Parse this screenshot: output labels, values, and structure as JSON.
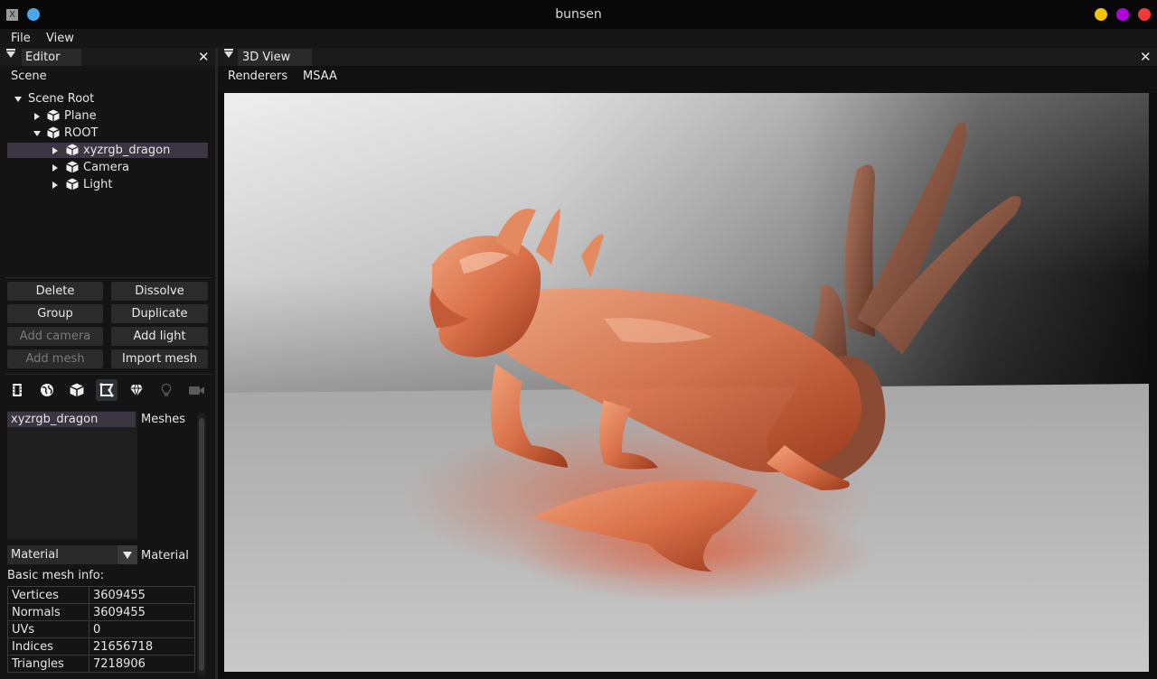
{
  "window": {
    "title": "bunsen",
    "controls": [
      "minimize",
      "maximize",
      "close"
    ],
    "control_colors": [
      "#f5c400",
      "#b400e0",
      "#f03a3a"
    ]
  },
  "menubar": {
    "file": "File",
    "view": "View"
  },
  "editor": {
    "tab": "Editor",
    "close": "✕",
    "scene_label": "Scene",
    "tree": {
      "root": "Scene Root",
      "plane": "Plane",
      "root_node": "ROOT",
      "dragon": "xyzrgb_dragon",
      "camera": "Camera",
      "light": "Light"
    },
    "buttons": {
      "delete": "Delete",
      "dissolve": "Dissolve",
      "group": "Group",
      "duplicate": "Duplicate",
      "add_camera": "Add camera",
      "add_light": "Add light",
      "add_mesh": "Add mesh",
      "import_mesh": "Import mesh"
    },
    "meshes": {
      "selected": "xyzrgb_dragon",
      "label": "Meshes"
    },
    "material": {
      "value": "Material",
      "label": "Material"
    },
    "info_title": "Basic mesh info:",
    "info": [
      {
        "k": "Vertices",
        "v": "3609455"
      },
      {
        "k": "Normals",
        "v": "3609455"
      },
      {
        "k": "UVs",
        "v": "0"
      },
      {
        "k": "Indices",
        "v": "21656718"
      },
      {
        "k": "Triangles",
        "v": "7218906"
      }
    ]
  },
  "view": {
    "tab": "3D View",
    "close": "✕",
    "renderers": "Renderers",
    "msaa": "MSAA"
  }
}
